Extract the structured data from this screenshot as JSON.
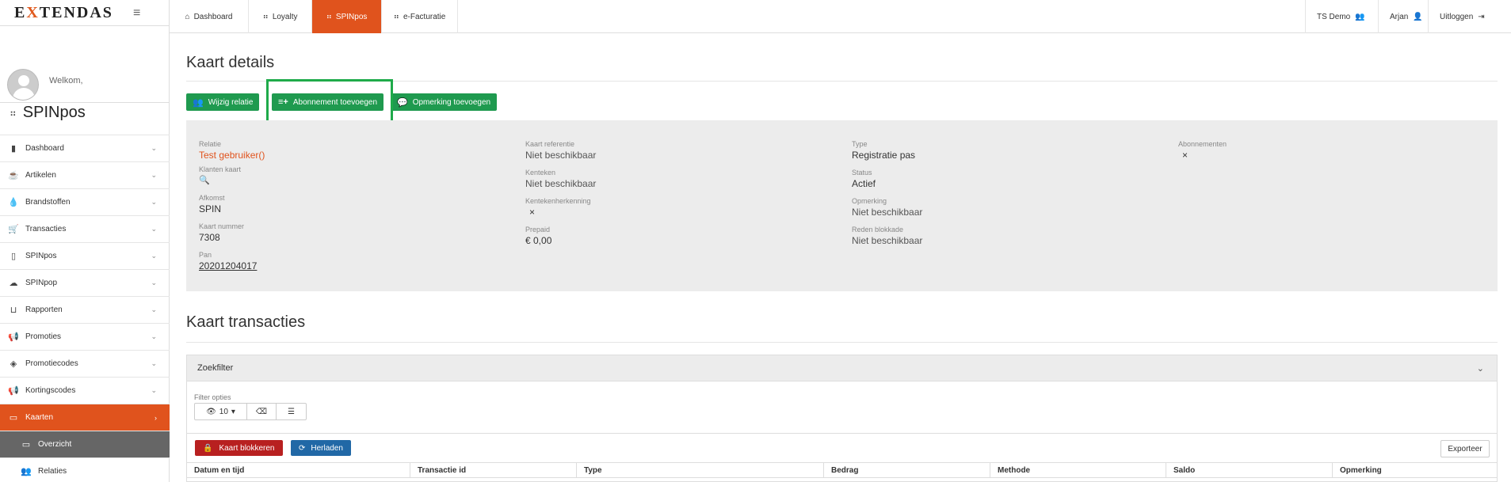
{
  "brand": {
    "logo_left": "E",
    "logo_x": "X",
    "logo_right": "TENDAS"
  },
  "sidebar": {
    "welcome": "Welkom,",
    "module_title": "SPINpos",
    "items": [
      {
        "label": "Dashboard",
        "icon": "bar-chart-icon"
      },
      {
        "label": "Artikelen",
        "icon": "coffee-cup-icon"
      },
      {
        "label": "Brandstoffen",
        "icon": "fuel-drop-icon"
      },
      {
        "label": "Transacties",
        "icon": "cart-icon"
      },
      {
        "label": "SPINpos",
        "icon": "mobile-icon"
      },
      {
        "label": "SPINpop",
        "icon": "cloud-icon"
      },
      {
        "label": "Rapporten",
        "icon": "basket-icon"
      },
      {
        "label": "Promoties",
        "icon": "megaphone-icon"
      },
      {
        "label": "Promotiecodes",
        "icon": "ticket-icon"
      },
      {
        "label": "Kortingscodes",
        "icon": "megaphone-icon"
      },
      {
        "label": "Kaarten",
        "icon": "credit-card-icon"
      },
      {
        "label": "Overzicht",
        "icon": "credit-card-icon"
      },
      {
        "label": "Relaties",
        "icon": "users-icon"
      }
    ]
  },
  "topbar": {
    "tabs": [
      {
        "label": "Dashboard",
        "icon": "home-icon"
      },
      {
        "label": "Loyalty",
        "icon": "grid-icon"
      },
      {
        "label": "SPINpos",
        "icon": "grid-icon"
      },
      {
        "label": "e-Facturatie",
        "icon": "grid-icon"
      }
    ],
    "org": "TS Demo",
    "user": "Arjan",
    "logout": "Uitloggen"
  },
  "page": {
    "title": "Kaart details",
    "buttons": {
      "edit_relation": "Wijzig relatie",
      "add_subscription": "Abonnement toevoegen",
      "add_remark": "Opmerking toevoegen"
    },
    "details": {
      "relatie_lbl": "Relatie",
      "relatie_val": "Test gebruiker()",
      "klantenkaart_lbl": "Klanten kaart",
      "afkomst_lbl": "Afkomst",
      "afkomst_val": "SPIN",
      "kaartnummer_lbl": "Kaart nummer",
      "kaartnummer_val": "7308",
      "pan_lbl": "Pan",
      "pan_val": "20201204017",
      "kaartref_lbl": "Kaart referentie",
      "kaartref_val": "Niet beschikbaar",
      "kenteken_lbl": "Kenteken",
      "kenteken_val": "Niet beschikbaar",
      "kentekenherkenning_lbl": "Kentekenherkenning",
      "kentekenherkenning_val": "×",
      "prepaid_lbl": "Prepaid",
      "prepaid_val": "€ 0,00",
      "type_lbl": "Type",
      "type_val": "Registratie pas",
      "status_lbl": "Status",
      "status_val": "Actief",
      "opmerking_lbl": "Opmerking",
      "opmerking_val": "Niet beschikbaar",
      "reden_lbl": "Reden blokkade",
      "reden_val": "Niet beschikbaar",
      "abonnementen_lbl": "Abonnementen",
      "abonnementen_val": "×"
    },
    "transactions_title": "Kaart transacties",
    "filter": {
      "header": "Zoekfilter",
      "options_label": "Filter opties",
      "page_size": "10"
    },
    "actions": {
      "block": "Kaart blokkeren",
      "reload": "Herladen",
      "export": "Exporteer"
    },
    "table_headers": [
      "Datum en tijd",
      "Transactie id",
      "Type",
      "Bedrag",
      "Methode",
      "Saldo",
      "Opmerking"
    ]
  },
  "colors": {
    "accent": "#e0531d",
    "green": "#1f9a4f",
    "red": "#b82020",
    "blue": "#2168a6"
  }
}
